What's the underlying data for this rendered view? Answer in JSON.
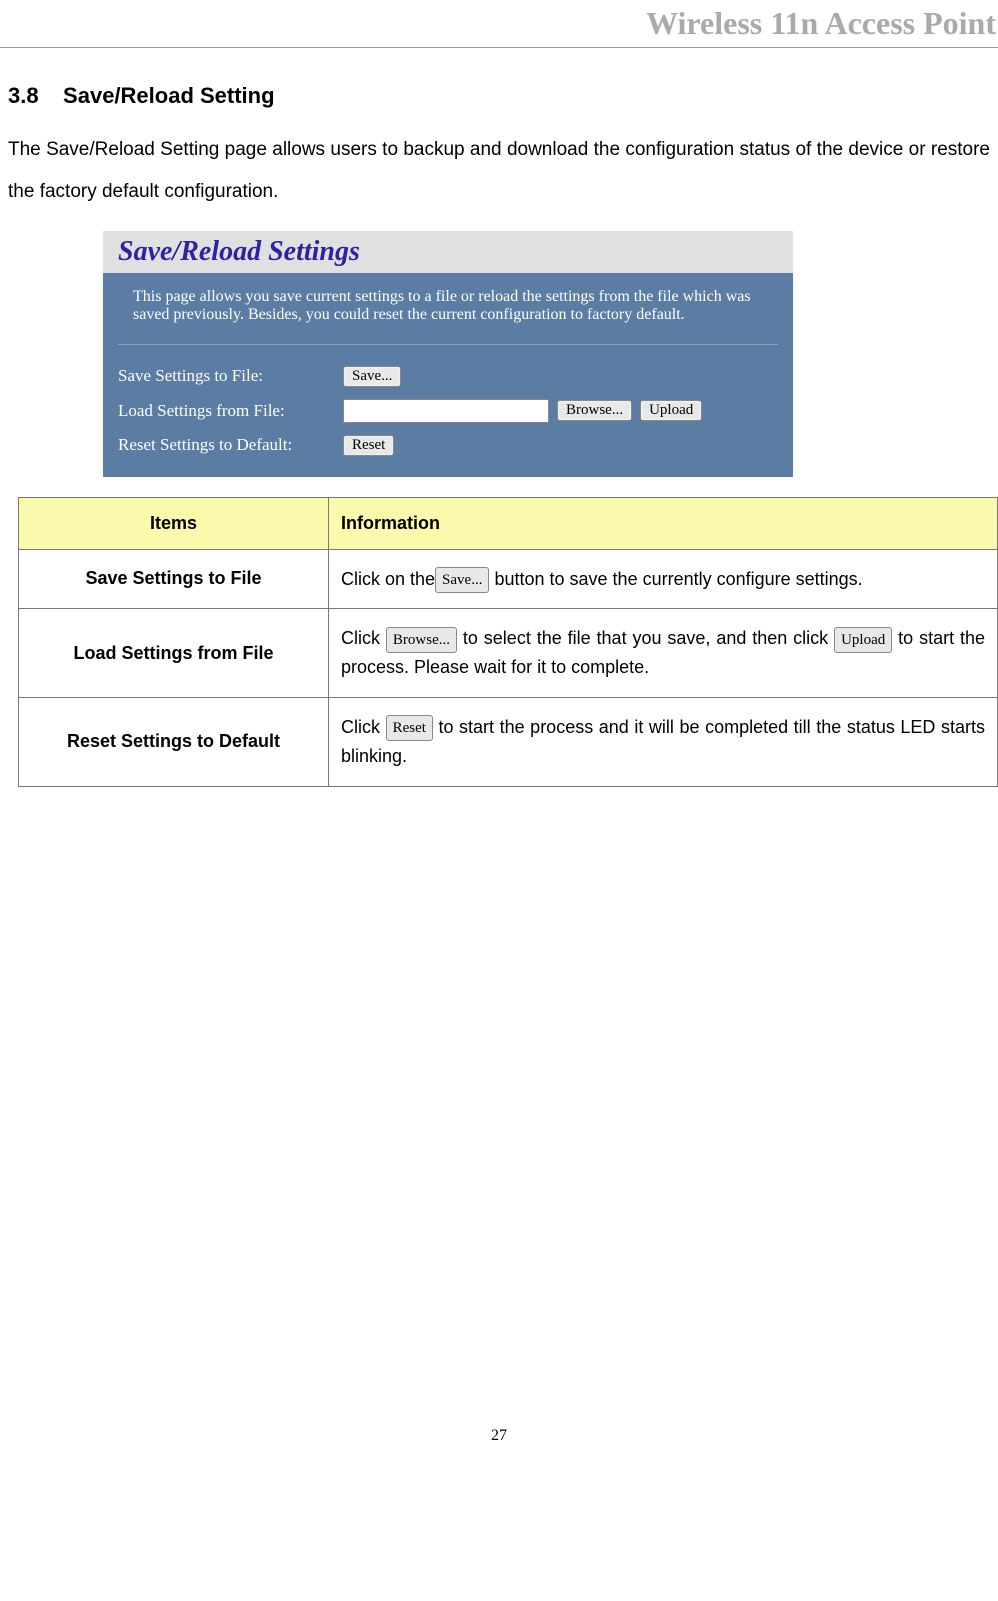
{
  "header": {
    "title": "Wireless 11n Access Point"
  },
  "section": {
    "number": "3.8",
    "title": "Save/Reload Setting",
    "intro": "The Save/Reload Setting page allows users to backup and download the configuration status of the device or restore the factory default configuration."
  },
  "screenshot": {
    "title": "Save/Reload Settings",
    "description": "This page allows you save current settings to a file or reload the settings from the file which was saved previously. Besides, you could reset the current configuration to factory default.",
    "rows": {
      "save": {
        "label": "Save Settings to File:",
        "button": "Save..."
      },
      "load": {
        "label": "Load Settings from File:",
        "browse": "Browse...",
        "upload": "Upload"
      },
      "reset": {
        "label": "Reset Settings to Default:",
        "button": "Reset"
      }
    }
  },
  "table": {
    "headers": {
      "items": "Items",
      "information": "Information"
    },
    "rows": [
      {
        "item": "Save Settings to File",
        "info_parts": {
          "p1": "Click on the",
          "btn1": "Save...",
          "p2": " button to save the currently configure settings."
        }
      },
      {
        "item": "Load Settings from File",
        "info_parts": {
          "p1": "Click ",
          "btn1": "Browse...",
          "p2": " to select the file that you save, and then click ",
          "btn2": "Upload",
          "p3": " to start the process. Please wait for it to complete."
        }
      },
      {
        "item": "Reset Settings to Default",
        "info_parts": {
          "p1": "Click ",
          "btn1": "Reset",
          "p2": " to start the process and it will be completed till the status LED starts blinking."
        }
      }
    ]
  },
  "page_number": "27"
}
